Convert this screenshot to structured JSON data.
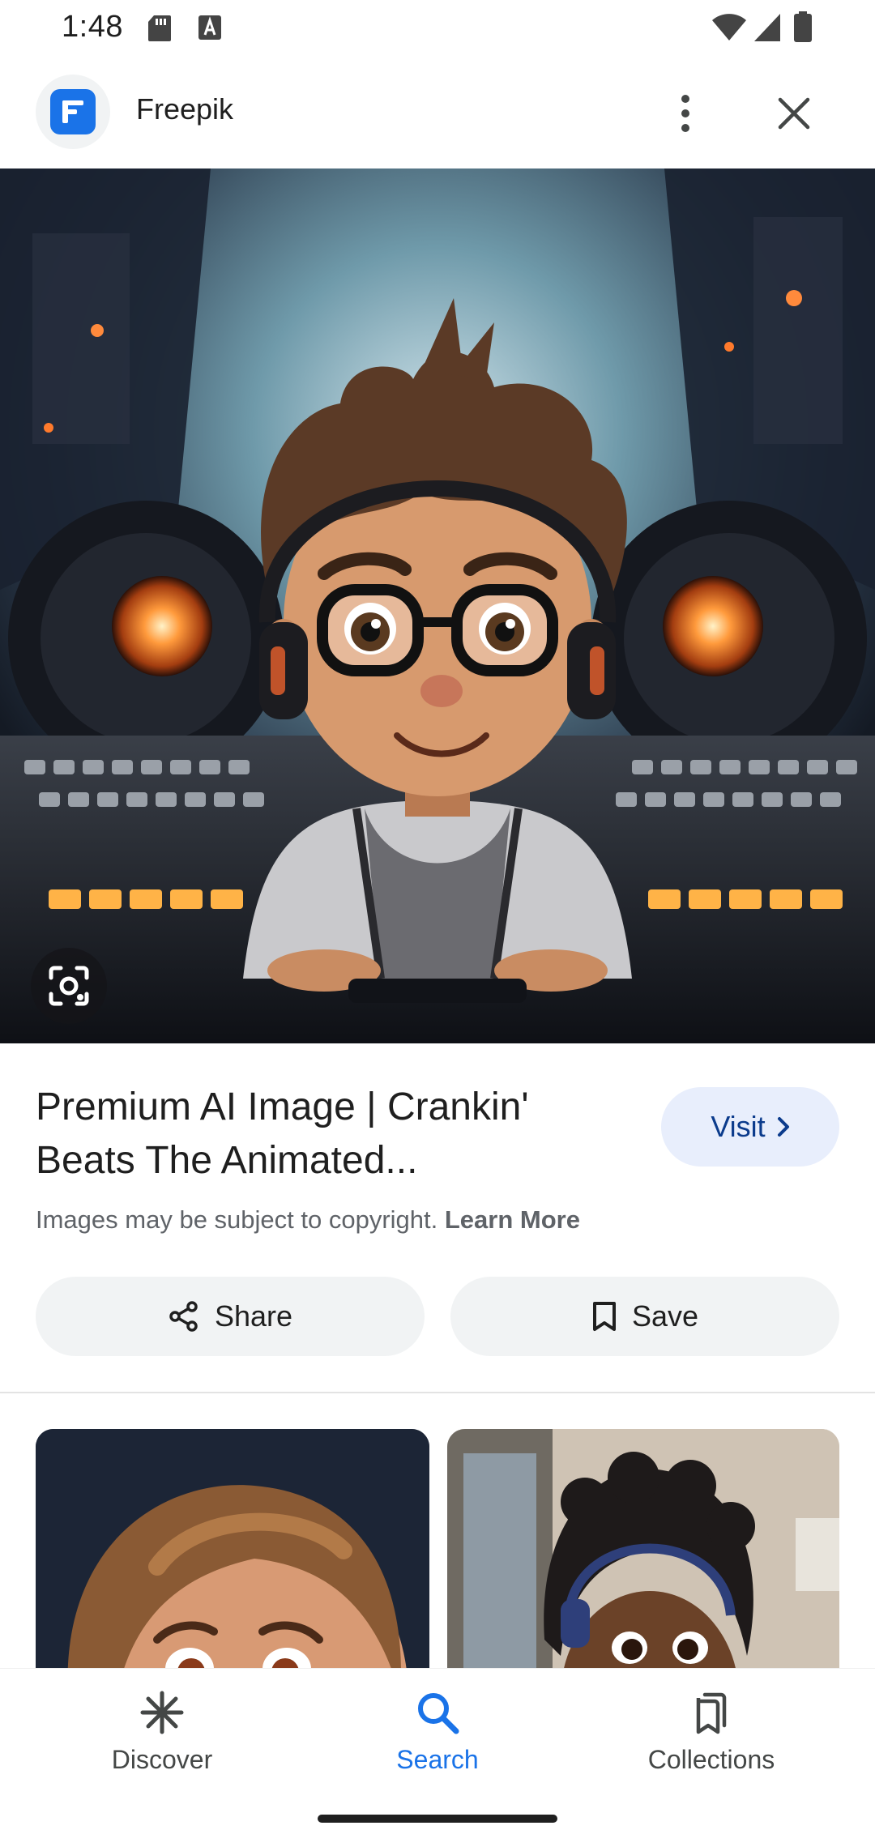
{
  "status_bar": {
    "time": "1:48",
    "icons": [
      "sd-card-icon",
      "a-notification-icon",
      "wifi-icon",
      "signal-icon",
      "battery-icon"
    ]
  },
  "header": {
    "site_name": "Freepik",
    "logo_icon": "freepik-logo-icon",
    "more_icon": "more-vert-icon",
    "close_icon": "close-icon"
  },
  "hero": {
    "lens_icon": "google-lens-icon"
  },
  "result": {
    "title": "Premium AI Image | Crankin' Beats The Animated...",
    "visit_label": "Visit",
    "copyright_text": "Images may be subject to copyright.",
    "learn_more": "Learn More"
  },
  "actions": {
    "share_label": "Share",
    "save_label": "Save"
  },
  "bottom_nav": {
    "items": [
      {
        "label": "Discover",
        "icon": "asterisk-icon",
        "active": false
      },
      {
        "label": "Search",
        "icon": "search-icon",
        "active": true
      },
      {
        "label": "Collections",
        "icon": "bookmarks-icon",
        "active": false
      }
    ]
  },
  "colors": {
    "accent": "#1a73e8",
    "visit_bg": "#e8eefc",
    "chip_bg": "#f1f3f4",
    "text_primary": "#1f1f1f",
    "text_secondary": "#5f6368"
  }
}
